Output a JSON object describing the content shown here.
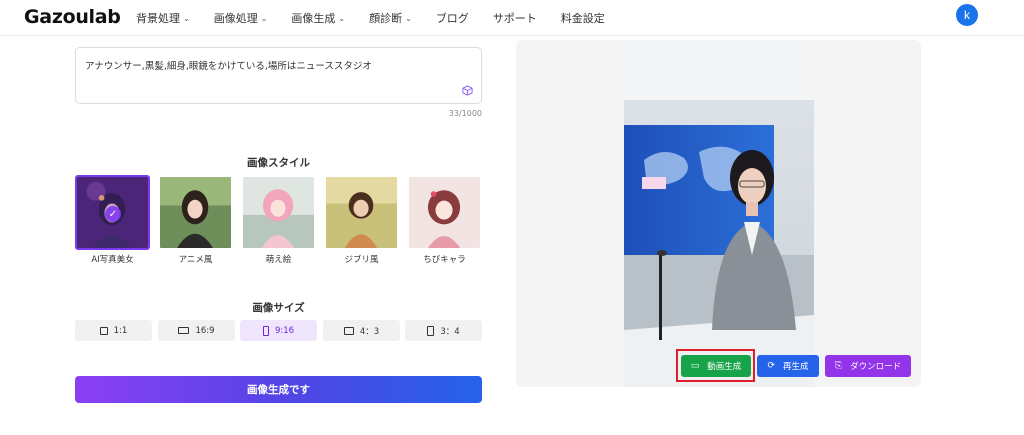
{
  "header": {
    "logo": "Gazoulab",
    "nav": [
      {
        "label": "背景処理",
        "dropdown": true
      },
      {
        "label": "画像処理",
        "dropdown": true
      },
      {
        "label": "画像生成",
        "dropdown": true
      },
      {
        "label": "顔診断",
        "dropdown": true
      },
      {
        "label": "ブログ",
        "dropdown": false
      },
      {
        "label": "サポート",
        "dropdown": false
      },
      {
        "label": "料金設定",
        "dropdown": false
      }
    ],
    "avatar_initial": "k"
  },
  "prompt": {
    "value": "アナウンサー,黒髪,細身,眼鏡をかけている,場所はニューススタジオ",
    "counter": "33/1000"
  },
  "style_section": {
    "title": "画像スタイル",
    "styles": [
      {
        "label": "AI写真美女",
        "selected": true
      },
      {
        "label": "アニメ風",
        "selected": false
      },
      {
        "label": "萌え絵",
        "selected": false
      },
      {
        "label": "ジブリ風",
        "selected": false
      },
      {
        "label": "ちびキャラ",
        "selected": false
      }
    ]
  },
  "size_section": {
    "title": "画像サイズ",
    "sizes": [
      {
        "label": "1:1",
        "selected": false
      },
      {
        "label": "16:9",
        "selected": false
      },
      {
        "label": "9:16",
        "selected": true
      },
      {
        "label": "4：3",
        "selected": false
      },
      {
        "label": "3：4",
        "selected": false
      }
    ]
  },
  "generate_button": "画像生成です",
  "result": {
    "actions": {
      "video": "動画生成",
      "regenerate": "再生成",
      "download": "ダウンロード"
    }
  },
  "colors": {
    "accent": "#7c3aed",
    "video": "#16a34a",
    "regenerate": "#2563eb",
    "download": "#9333ea",
    "highlight": "#e11d2a",
    "avatar": "#1a73e8"
  },
  "icons": {
    "nav_dropdown": "chevron-down-icon",
    "prompt_tool": "cube-icon",
    "style_selected": "check-icon",
    "video": "video-camera-icon",
    "regenerate": "refresh-icon",
    "download": "download-file-icon"
  }
}
